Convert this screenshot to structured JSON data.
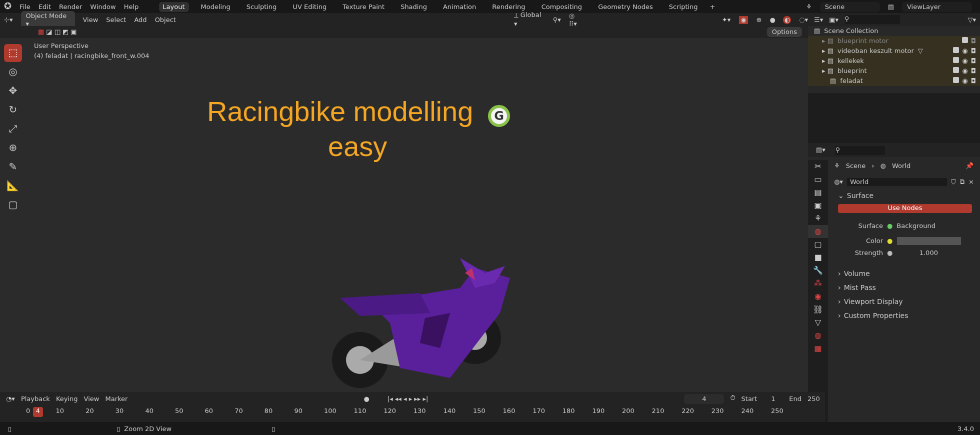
{
  "menubar": {
    "items": [
      "File",
      "Edit",
      "Render",
      "Window",
      "Help"
    ],
    "workspaces": [
      "Layout",
      "Modeling",
      "Sculpting",
      "UV Editing",
      "Texture Paint",
      "Shading",
      "Animation",
      "Rendering",
      "Compositing",
      "Geometry Nodes",
      "Scripting"
    ],
    "active_workspace": "Layout",
    "scene": "Scene",
    "view_layer": "ViewLayer"
  },
  "header": {
    "mode": "Object Mode",
    "menus": [
      "View",
      "Select",
      "Add",
      "Object"
    ],
    "transform": "Global",
    "options": "Options"
  },
  "viewport": {
    "perspective": "User Perspective",
    "object_info": "(4) feladat | racingbike_front_w.004",
    "title_line1": "Racingbike modelling",
    "title_line2": "easy"
  },
  "outliner": {
    "root": "Scene Collection",
    "items": [
      {
        "name": "blueprint motor",
        "dim": true
      },
      {
        "name": "videoban keszult motor"
      },
      {
        "name": "kellekek"
      },
      {
        "name": "blueprint"
      },
      {
        "name": "feladat"
      }
    ]
  },
  "properties": {
    "breadcrumb": [
      "Scene",
      "World"
    ],
    "world_name": "World",
    "surface_label": "Surface",
    "use_nodes": "Use Nodes",
    "surface_field": "Surface",
    "surface_value": "Background",
    "color_label": "Color",
    "strength_label": "Strength",
    "strength_value": "1.000",
    "sections": [
      "Volume",
      "Mist Pass",
      "Viewport Display",
      "Custom Properties"
    ]
  },
  "timeline": {
    "menus": [
      "Playback",
      "Keying",
      "View",
      "Marker"
    ],
    "current_frame": "4",
    "start_label": "Start",
    "start": "1",
    "end_label": "End",
    "end": "250",
    "ticks": [
      "0",
      "10",
      "20",
      "30",
      "40",
      "50",
      "60",
      "70",
      "80",
      "90",
      "100",
      "110",
      "120",
      "130",
      "140",
      "150",
      "160",
      "170",
      "180",
      "190",
      "200",
      "210",
      "220",
      "230",
      "240",
      "250"
    ]
  },
  "status": {
    "hint": "Zoom 2D View",
    "version": "3.4.0"
  },
  "colors": {
    "accent": "#b03a2e",
    "title": "#f5a623"
  }
}
